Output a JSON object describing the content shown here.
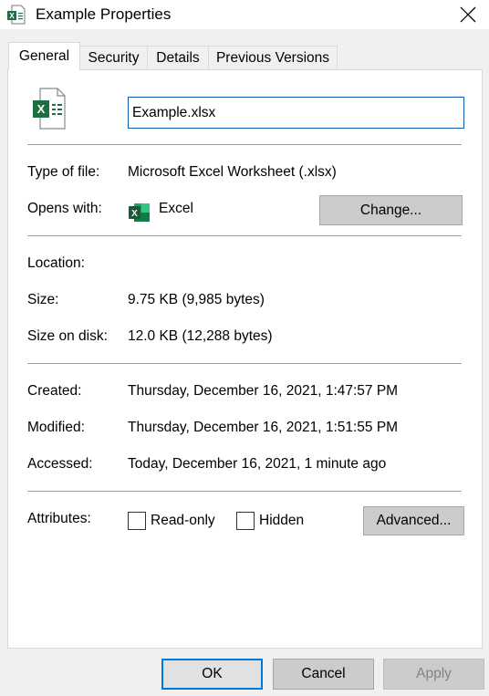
{
  "window": {
    "title": "Example Properties",
    "title_icon": "excel-file-icon",
    "close_icon": "close-icon"
  },
  "tabs": [
    {
      "label": "General",
      "active": true
    },
    {
      "label": "Security",
      "active": false
    },
    {
      "label": "Details",
      "active": false
    },
    {
      "label": "Previous Versions",
      "active": false
    }
  ],
  "general": {
    "file_name": "Example.xlsx",
    "type_label": "Type of file:",
    "type_value": "Microsoft Excel Worksheet (.xlsx)",
    "opens_label": "Opens with:",
    "opens_app": "Excel",
    "change_button": "Change...",
    "location_label": "Location:",
    "location_value": "",
    "size_label": "Size:",
    "size_value": "9.75 KB (9,985 bytes)",
    "size_on_disk_label": "Size on disk:",
    "size_on_disk_value": "12.0 KB (12,288 bytes)",
    "created_label": "Created:",
    "created_value": "Thursday, December 16, 2021, 1:47:57 PM",
    "modified_label": "Modified:",
    "modified_value": "Thursday, December 16, 2021, 1:51:55 PM",
    "accessed_label": "Accessed:",
    "accessed_value": "Today, December 16, 2021, 1 minute ago",
    "attributes_label": "Attributes:",
    "readonly_label": "Read-only",
    "readonly_checked": false,
    "hidden_label": "Hidden",
    "hidden_checked": false,
    "advanced_button": "Advanced..."
  },
  "footer": {
    "ok_label": "OK",
    "cancel_label": "Cancel",
    "apply_label": "Apply"
  },
  "colors": {
    "excel_green": "#1d6f42",
    "focus_blue": "#0078d7"
  }
}
